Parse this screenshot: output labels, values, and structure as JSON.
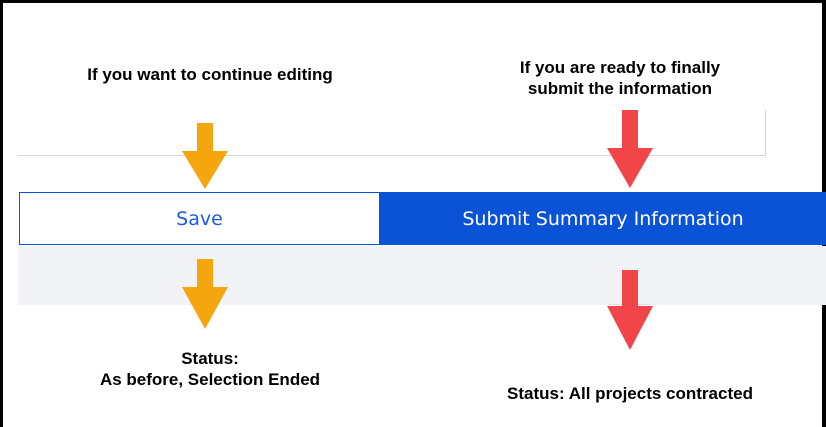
{
  "annotations": {
    "continue_editing": "If you want to continue editing",
    "ready_to_submit": "If you are ready to finally\nsubmit the information",
    "save_status": "Status:\nAs before, Selection Ended",
    "submit_status": "Status: All projects contracted"
  },
  "buttons": {
    "save_label": "Save",
    "submit_label": "Submit Summary Information"
  },
  "colors": {
    "accent_blue": "#0a53d6",
    "arrow_orange": "#f5a50d",
    "arrow_red": "#f2454a"
  },
  "icons": {
    "save_arrows": "arrow-down-icon (orange)",
    "submit_arrows": "arrow-down-icon (red)"
  }
}
